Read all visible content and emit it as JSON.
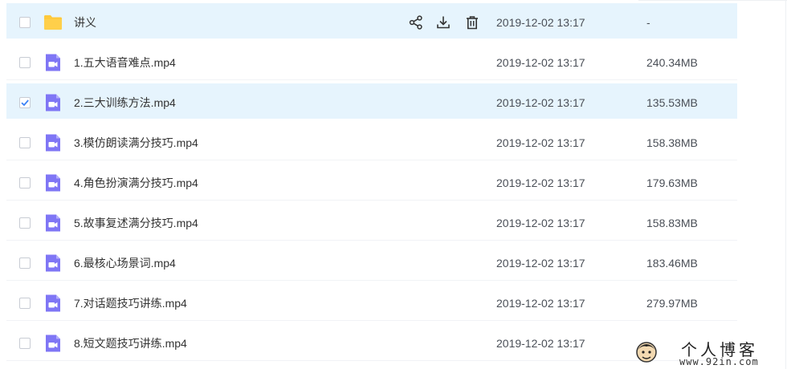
{
  "files": [
    {
      "name": "讲义",
      "type": "folder",
      "date": "2019-12-02 13:17",
      "size": "-",
      "checked": false,
      "hover": true
    },
    {
      "name": "1.五大语音难点.mp4",
      "type": "video",
      "date": "2019-12-02 13:17",
      "size": "240.34MB",
      "checked": false,
      "hover": false
    },
    {
      "name": "2.三大训练方法.mp4",
      "type": "video",
      "date": "2019-12-02 13:17",
      "size": "135.53MB",
      "checked": true,
      "hover": false
    },
    {
      "name": "3.模仿朗读满分技巧.mp4",
      "type": "video",
      "date": "2019-12-02 13:17",
      "size": "158.38MB",
      "checked": false,
      "hover": false
    },
    {
      "name": "4.角色扮演满分技巧.mp4",
      "type": "video",
      "date": "2019-12-02 13:17",
      "size": "179.63MB",
      "checked": false,
      "hover": false
    },
    {
      "name": "5.故事复述满分技巧.mp4",
      "type": "video",
      "date": "2019-12-02 13:17",
      "size": "158.83MB",
      "checked": false,
      "hover": false
    },
    {
      "name": "6.最核心场景词.mp4",
      "type": "video",
      "date": "2019-12-02 13:17",
      "size": "183.46MB",
      "checked": false,
      "hover": false
    },
    {
      "name": "7.对话题技巧讲练.mp4",
      "type": "video",
      "date": "2019-12-02 13:17",
      "size": "279.97MB",
      "checked": false,
      "hover": false
    },
    {
      "name": "8.短文题技巧讲练.mp4",
      "type": "video",
      "date": "2019-12-02 13:17",
      "size": "",
      "checked": false,
      "hover": false
    }
  ],
  "row_actions": [
    "share-icon",
    "download-icon",
    "delete-icon"
  ],
  "watermark": {
    "title": "个人博客",
    "url": "www.92in.com"
  },
  "colors": {
    "highlight": "#e6f4fd",
    "folder": "#ffc93c",
    "video": "#7f76f5",
    "checkmark": "#3b82f6"
  }
}
